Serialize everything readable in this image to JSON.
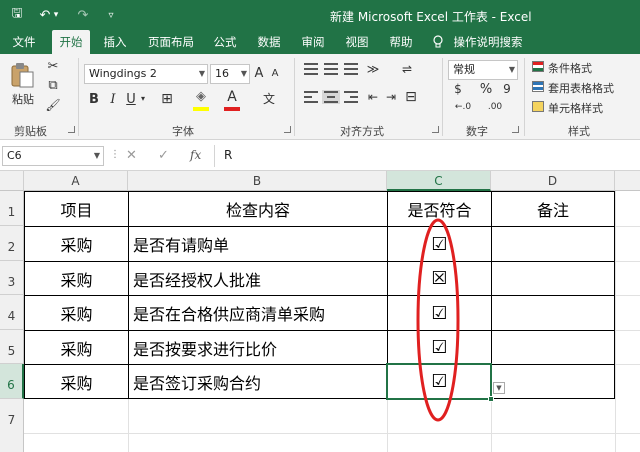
{
  "window": {
    "title": "新建 Microsoft Excel 工作表 - Excel",
    "quick_access": {
      "save": "🖫",
      "undo": "↶",
      "undo_dd": "▾",
      "redo": "↷",
      "customize": "▿"
    }
  },
  "tabs": [
    "文件",
    "开始",
    "插入",
    "页面布局",
    "公式",
    "数据",
    "审阅",
    "视图",
    "帮助"
  ],
  "active_tab": "开始",
  "tell_me": "操作说明搜索",
  "ribbon": {
    "clipboard": {
      "label": "剪贴板",
      "paste": "粘贴",
      "cut": "✂",
      "copy": "⧉",
      "painter": "🖌"
    },
    "font": {
      "label": "字体",
      "name": "Wingdings 2",
      "size": "16",
      "grow": "A",
      "shrink": "A",
      "bold": "B",
      "italic": "I",
      "underline": "U",
      "underline_dd": "▾",
      "border": "⊞",
      "fill": "◈",
      "fontcolor": "A",
      "phonetic": "文"
    },
    "align": {
      "label": "对齐方式",
      "orient": "≫",
      "wrap": "⇌",
      "merge": "⊟",
      "indent_dec": "⇤",
      "indent_inc": "⇥"
    },
    "number": {
      "label": "数字",
      "format": "常规",
      "currency": "$",
      "percent": "%",
      "comma": "9",
      "inc_dec": "←.0",
      "dec_dec": ".00"
    },
    "styles": {
      "label": "样式",
      "conditional": "条件格式",
      "table": "套用表格格式",
      "cell": "单元格样式"
    }
  },
  "formula_bar": {
    "name_box": "C6",
    "fx": "fx",
    "cancel": "✕",
    "enter": "✓",
    "content": "R"
  },
  "columns": [
    "A",
    "B",
    "C",
    "D"
  ],
  "rows": [
    "1",
    "2",
    "3",
    "4",
    "5",
    "6",
    "7"
  ],
  "table": {
    "header": [
      "项目",
      "检查内容",
      "是否符合",
      "备注"
    ],
    "rows": [
      [
        "采购",
        "是否有请购单",
        "☑",
        ""
      ],
      [
        "采购",
        "是否经授权人批准",
        "☒",
        ""
      ],
      [
        "采购",
        "是否在合格供应商清单采购",
        "☑",
        ""
      ],
      [
        "采购",
        "是否按要求进行比价",
        "☑",
        ""
      ],
      [
        "采购",
        "是否签订采购合约",
        "☑",
        ""
      ]
    ]
  },
  "colors": {
    "excel_green": "#217346",
    "annotation": "#e02020"
  }
}
